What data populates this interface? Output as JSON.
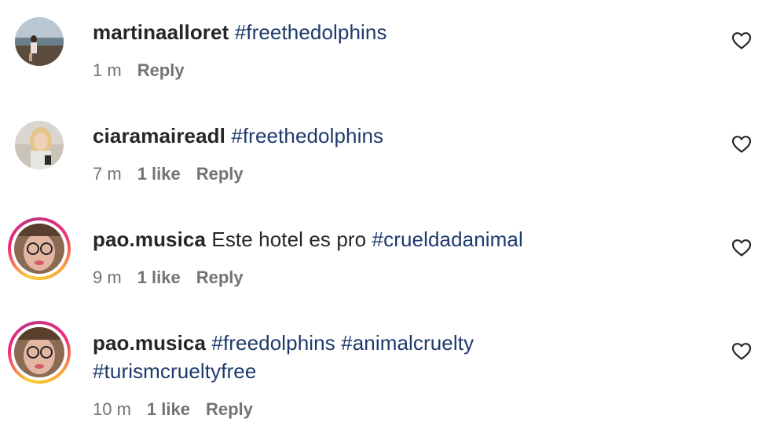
{
  "comments": [
    {
      "username": "martinaalloret",
      "text_parts": [
        {
          "kind": "hashtag",
          "text": "#freethedolphins"
        }
      ],
      "time": "1 m",
      "likes": "",
      "reply": "Reply"
    },
    {
      "username": "ciaramaireadl",
      "text_parts": [
        {
          "kind": "hashtag",
          "text": "#freethedolphins"
        }
      ],
      "time": "7 m",
      "likes": "1 like",
      "reply": "Reply"
    },
    {
      "username": "pao.musica",
      "text_parts": [
        {
          "kind": "text",
          "text": "Este hotel es pro"
        },
        {
          "kind": "hashtag",
          "text": "#crueldadanimal"
        }
      ],
      "time": "9 m",
      "likes": "1 like",
      "reply": "Reply"
    },
    {
      "username": "pao.musica",
      "text_parts": [
        {
          "kind": "hashtag",
          "text": "#freedolphins"
        },
        {
          "kind": "hashtag",
          "text": "#animalcruelty"
        },
        {
          "kind": "hashtag",
          "text": "#turismcrueltyfree"
        }
      ],
      "time": "10 m",
      "likes": "1 like",
      "reply": "Reply"
    }
  ],
  "icons": {
    "like": "heart-icon"
  },
  "colors": {
    "hashtag": "#1e3a6b",
    "meta": "#737373",
    "username": "#262626"
  }
}
